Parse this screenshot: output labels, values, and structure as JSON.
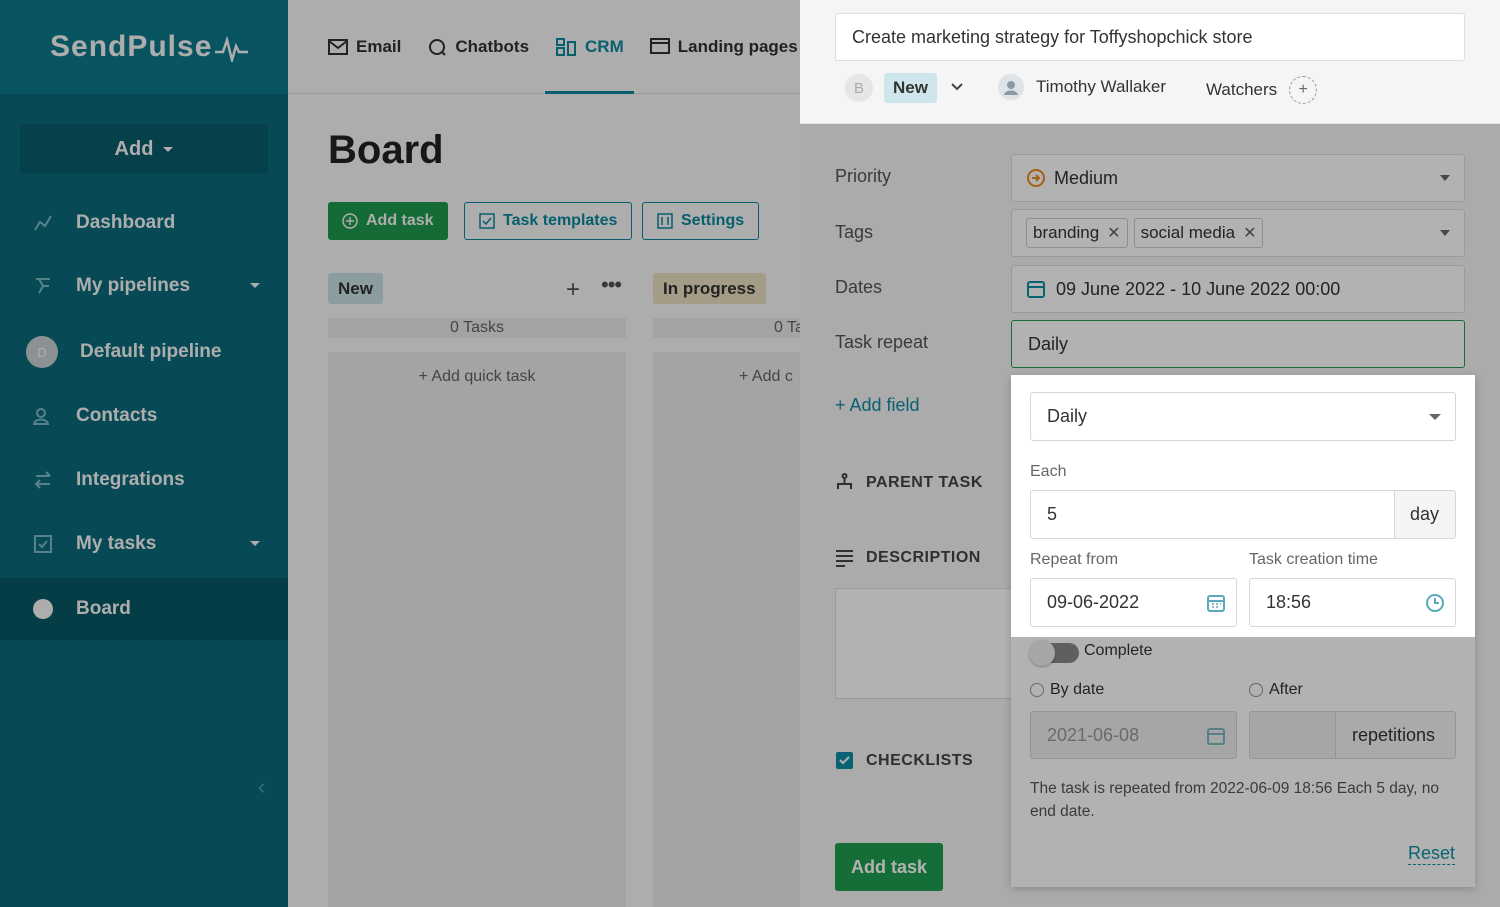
{
  "sidebar": {
    "logo": "SendPulse",
    "add_label": "Add",
    "items": [
      {
        "label": "Dashboard"
      },
      {
        "label": "My pipelines"
      },
      {
        "label": "Default pipeline",
        "avatar": "D"
      },
      {
        "label": "Contacts"
      },
      {
        "label": "Integrations"
      },
      {
        "label": "My tasks"
      },
      {
        "label": "Board"
      }
    ]
  },
  "topnav": {
    "tabs": [
      {
        "label": "Email"
      },
      {
        "label": "Chatbots"
      },
      {
        "label": "CRM"
      },
      {
        "label": "Landing pages"
      }
    ]
  },
  "board": {
    "title": "Board",
    "add_task": "Add task",
    "task_templates": "Task templates",
    "settings": "Settings",
    "columns": [
      {
        "name": "New",
        "count": "0 Tasks",
        "quick": "Add quick task"
      },
      {
        "name": "In progress",
        "count": "0 Ta",
        "quick": "Add c"
      }
    ]
  },
  "task": {
    "title": "Create marketing strategy for Toffyshopchick store",
    "status_avatar": "B",
    "status": "New",
    "assignee": "Timothy Wallaker",
    "watchers": "Watchers",
    "fields": {
      "priority_label": "Priority",
      "priority_value": "Medium",
      "tags_label": "Tags",
      "tags": [
        "branding",
        "social media"
      ],
      "dates_label": "Dates",
      "dates_value": "09 June 2022 - 10 June 2022 00:00",
      "repeat_label": "Task repeat",
      "repeat_value": "Daily"
    },
    "add_field": "+ Add field",
    "sections": {
      "parent": "PARENT TASK",
      "description": "DESCRIPTION",
      "checklists": "CHECKLISTS"
    },
    "submit": "Add task"
  },
  "repeat_popup": {
    "frequency": "Daily",
    "each_label": "Each",
    "each_value": "5",
    "each_unit": "day",
    "repeat_from_label": "Repeat from",
    "repeat_from_value": "09-06-2022",
    "creation_time_label": "Task creation time",
    "creation_time_value": "18:56",
    "complete_label": "Complete",
    "by_date_label": "By date",
    "after_label": "After",
    "end_date_value": "2021-06-08",
    "repetitions_label": "repetitions",
    "summary": "The task is repeated from 2022-06-09 18:56 Each 5 day, no end date.",
    "reset": "Reset"
  },
  "colors": {
    "sidebar": "#0b6d7e",
    "accent": "#0d8da3",
    "green": "#1f9e4f"
  }
}
